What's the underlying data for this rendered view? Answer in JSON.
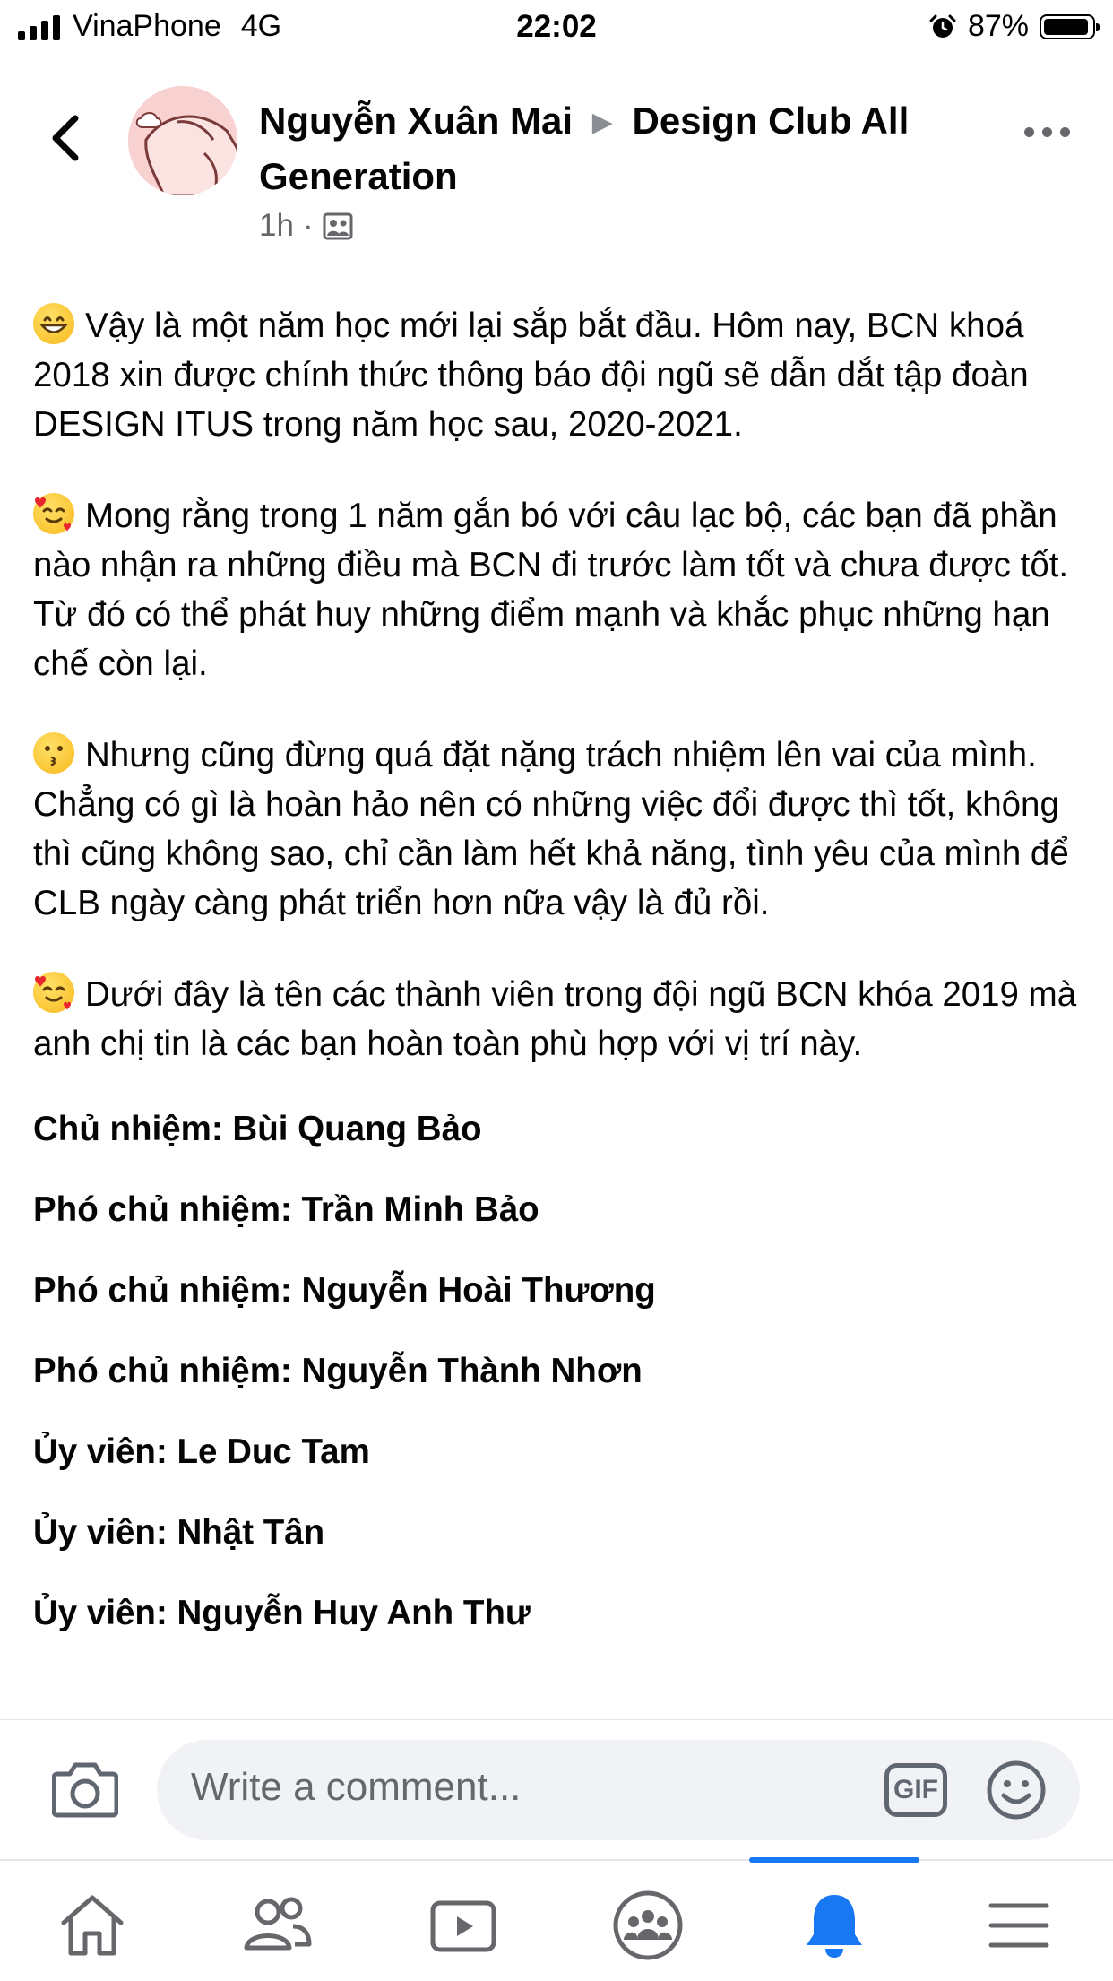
{
  "status_bar": {
    "carrier": "VinaPhone",
    "network": "4G",
    "time": "22:02",
    "battery": "87%",
    "battery_level": 0.87,
    "icons": [
      "signal-icon",
      "alarm-icon",
      "battery-icon"
    ]
  },
  "header": {
    "author": "Nguyễn Xuân Mai",
    "group": "Design Club All Generation",
    "time_ago": "1h",
    "separator": "·",
    "privacy_icon": "group-icon",
    "back_icon": "chevron-left-icon",
    "more_icon": "more-dots-icon"
  },
  "post": {
    "paragraphs": [
      {
        "emoji": "grinning-face",
        "text": "Vậy là một năm học mới lại sắp bắt đầu. Hôm nay, BCN khoá 2018 xin được chính thức thông báo đội ngũ sẽ dẫn dắt tập đoàn DESIGN ITUS trong năm học sau, 2020-2021."
      },
      {
        "emoji": "smiling-face-with-hearts",
        "text": "Mong rằng trong 1 năm gắn bó với câu lạc bộ, các bạn đã phần nào nhận ra những điều mà BCN đi trước làm tốt và chưa được tốt. Từ đó có thể phát huy những điểm mạnh và khắc phục những hạn chế còn lại."
      },
      {
        "emoji": "kissing-face",
        "text": "Nhưng cũng đừng quá đặt nặng trách nhiệm lên vai của mình. Chẳng có gì là hoàn hảo nên có những việc đổi được thì tốt, không thì cũng không sao, chỉ cần làm hết khả năng, tình yêu của mình để CLB ngày càng phát triển hơn nữa vậy là đủ rồi."
      },
      {
        "emoji": "smiling-face-with-hearts",
        "text": "Dưới đây là tên các thành viên trong đội ngũ BCN khóa 2019 mà anh chị tin là các bạn hoàn toàn phù hợp với vị trí này."
      }
    ],
    "members": [
      "Chủ nhiệm: Bùi Quang Bảo",
      "Phó chủ nhiệm: Trần Minh Bảo",
      "Phó chủ nhiệm: Nguyễn Hoài Thương",
      "Phó chủ nhiệm: Nguyễn Thành Nhơn",
      "Ủy viên: Le Duc Tam",
      "Ủy viên: Nhật Tân",
      "Ủy viên: Nguyễn Huy Anh Thư"
    ]
  },
  "comment_bar": {
    "placeholder": "Write a comment...",
    "gif_label": "GIF",
    "camera_icon": "camera-icon",
    "smile_icon": "emoji-icon"
  },
  "tabbar": {
    "tabs": [
      {
        "name": "home-icon",
        "active": false
      },
      {
        "name": "friends-icon",
        "active": false
      },
      {
        "name": "watch-icon",
        "active": false
      },
      {
        "name": "groups-icon",
        "active": false
      },
      {
        "name": "notifications-icon",
        "active": true
      },
      {
        "name": "menu-icon",
        "active": false
      }
    ],
    "active_color": "#1877f2",
    "inactive_color": "#65676b"
  }
}
